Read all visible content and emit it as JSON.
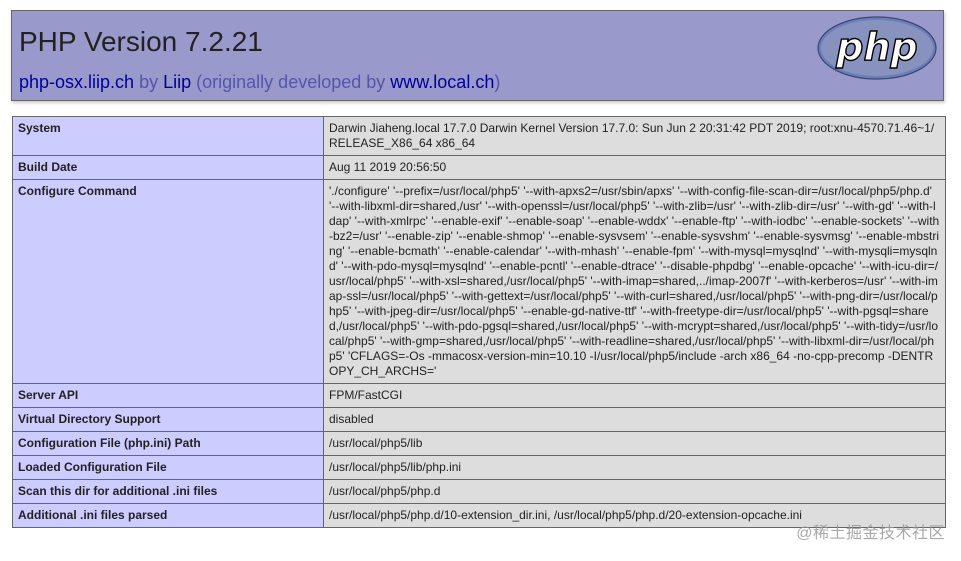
{
  "header": {
    "title": "PHP Version 7.2.21",
    "site_link": "php-osx.liip.ch",
    "by_text": "by",
    "company_link": "Liip",
    "orig_prefix": "(originally developed by",
    "orig_link": "www.local.ch",
    "orig_suffix": ")",
    "logo_text": "php"
  },
  "rows": [
    {
      "name": "System",
      "value": "Darwin Jiaheng.local 17.7.0 Darwin Kernel Version 17.7.0: Sun Jun 2 20:31:42 PDT 2019; root:xnu-4570.71.46~1/RELEASE_X86_64 x86_64"
    },
    {
      "name": "Build Date",
      "value": "Aug 11 2019 20:56:50"
    },
    {
      "name": "Configure Command",
      "value": "'./configure' '--prefix=/usr/local/php5' '--with-apxs2=/usr/sbin/apxs' '--with-config-file-scan-dir=/usr/local/php5/php.d' '--with-libxml-dir=shared,/usr' '--with-openssl=/usr/local/php5' '--with-zlib=/usr' '--with-zlib-dir=/usr' '--with-gd' '--with-ldap' '--with-xmlrpc' '--enable-exif' '--enable-soap' '--enable-wddx' '--enable-ftp' '--with-iodbc' '--enable-sockets' '--with-bz2=/usr' '--enable-zip' '--enable-shmop' '--enable-sysvsem' '--enable-sysvshm' '--enable-sysvmsg' '--enable-mbstring' '--enable-bcmath' '--enable-calendar' '--with-mhash' '--enable-fpm' '--with-mysql=mysqlnd' '--with-mysqli=mysqlnd' '--with-pdo-mysql=mysqlnd' '--enable-pcntl' '--enable-dtrace' '--disable-phpdbg' '--enable-opcache' '--with-icu-dir=/usr/local/php5' '--with-xsl=shared,/usr/local/php5' '--with-imap=shared,../imap-2007f' '--with-kerberos=/usr' '--with-imap-ssl=/usr/local/php5' '--with-gettext=/usr/local/php5' '--with-curl=shared,/usr/local/php5' '--with-png-dir=/usr/local/php5' '--with-jpeg-dir=/usr/local/php5' '--enable-gd-native-ttf' '--with-freetype-dir=/usr/local/php5' '--with-pgsql=shared,/usr/local/php5' '--with-pdo-pgsql=shared,/usr/local/php5' '--with-mcrypt=shared,/usr/local/php5' '--with-tidy=/usr/local/php5' '--with-gmp=shared,/usr/local/php5' '--with-readline=shared,/usr/local/php5' '--with-libxml-dir=/usr/local/php5' 'CFLAGS=-Os -mmacosx-version-min=10.10 -I/usr/local/php5/include -arch x86_64 -no-cpp-precomp -DENTROPY_CH_ARCHS='"
    },
    {
      "name": "Server API",
      "value": "FPM/FastCGI"
    },
    {
      "name": "Virtual Directory Support",
      "value": "disabled"
    },
    {
      "name": "Configuration File (php.ini) Path",
      "value": "/usr/local/php5/lib"
    },
    {
      "name": "Loaded Configuration File",
      "value": "/usr/local/php5/lib/php.ini"
    },
    {
      "name": "Scan this dir for additional .ini files",
      "value": "/usr/local/php5/php.d"
    },
    {
      "name": "Additional .ini files parsed",
      "value": "/usr/local/php5/php.d/10-extension_dir.ini, /usr/local/php5/php.d/20-extension-opcache.ini"
    }
  ],
  "watermark": "@稀土掘金技术社区",
  "colors": {
    "header_bg": "#9999cc",
    "label_bg": "#ccccff",
    "value_bg": "#dddddd",
    "link": "#000099"
  }
}
